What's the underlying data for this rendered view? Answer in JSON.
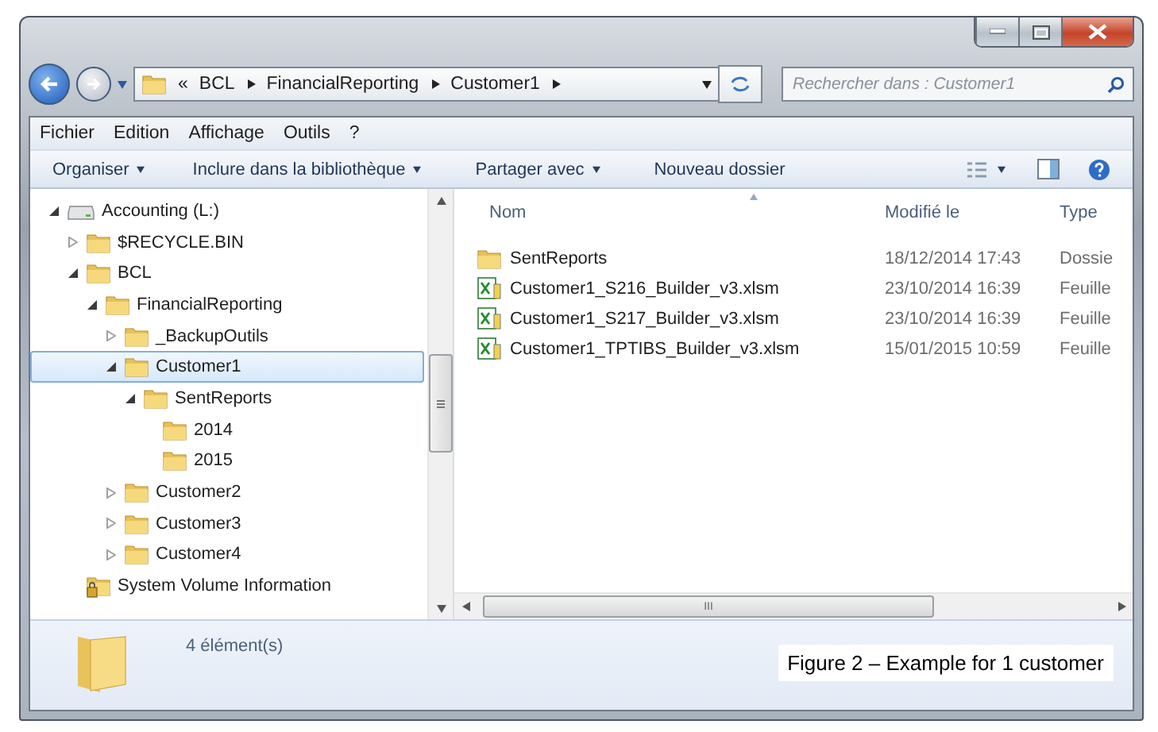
{
  "address": {
    "overflow": "«",
    "crumbs": [
      "BCL",
      "FinancialReporting",
      "Customer1"
    ]
  },
  "search": {
    "placeholder": "Rechercher dans : Customer1"
  },
  "menu": [
    {
      "label": "Fichier"
    },
    {
      "label": "Edition"
    },
    {
      "label": "Affichage"
    },
    {
      "label": "Outils"
    },
    {
      "label": "?"
    }
  ],
  "toolbar": [
    {
      "label": "Organiser",
      "dropdown": true
    },
    {
      "label": "Inclure dans la bibliothèque",
      "dropdown": true
    },
    {
      "label": "Partager avec",
      "dropdown": true
    },
    {
      "label": "Nouveau dossier",
      "dropdown": false
    }
  ],
  "tree": [
    {
      "label": "Accounting (L:)",
      "kind": "drive",
      "expanded": true,
      "selected": false,
      "children": [
        {
          "label": "$RECYCLE.BIN",
          "kind": "folder",
          "expanded": false,
          "selected": false
        },
        {
          "label": "BCL",
          "kind": "folder",
          "expanded": true,
          "selected": false,
          "children": [
            {
              "label": "FinancialReporting",
              "kind": "folder",
              "expanded": true,
              "selected": false,
              "children": [
                {
                  "label": "_BackupOutils",
                  "kind": "folder",
                  "expanded": false,
                  "selected": false
                },
                {
                  "label": "Customer1",
                  "kind": "folder",
                  "expanded": true,
                  "selected": true,
                  "children": [
                    {
                      "label": "SentReports",
                      "kind": "folder",
                      "expanded": true,
                      "selected": false,
                      "children": [
                        {
                          "label": "2014",
                          "kind": "folder",
                          "selected": false
                        },
                        {
                          "label": "2015",
                          "kind": "folder",
                          "selected": false
                        }
                      ]
                    }
                  ]
                },
                {
                  "label": "Customer2",
                  "kind": "folder",
                  "expanded": false,
                  "selected": false
                },
                {
                  "label": "Customer3",
                  "kind": "folder",
                  "expanded": false,
                  "selected": false
                },
                {
                  "label": "Customer4",
                  "kind": "folder",
                  "expanded": false,
                  "selected": false
                }
              ]
            }
          ]
        },
        {
          "label": "System Volume Information",
          "kind": "locked-folder",
          "selected": false
        }
      ]
    }
  ],
  "columns": [
    "Nom",
    "Modifié le",
    "Type"
  ],
  "files": [
    {
      "kind": "folder",
      "name": "SentReports",
      "modified": "18/12/2014 17:43",
      "type": "Dossie"
    },
    {
      "kind": "spreadsheet",
      "name": "Customer1_S216_Builder_v3.xlsm",
      "modified": "23/10/2014 16:39",
      "type": "Feuille"
    },
    {
      "kind": "spreadsheet",
      "name": "Customer1_S217_Builder_v3.xlsm",
      "modified": "23/10/2014 16:39",
      "type": "Feuille"
    },
    {
      "kind": "spreadsheet",
      "name": "Customer1_TPTIBS_Builder_v3.xlsm",
      "modified": "15/01/2015 10:59",
      "type": "Feuille"
    }
  ],
  "hscroll_grip": "III",
  "status": {
    "count": "4 élément(s)"
  },
  "caption": "Figure 2 – Example for 1 customer"
}
